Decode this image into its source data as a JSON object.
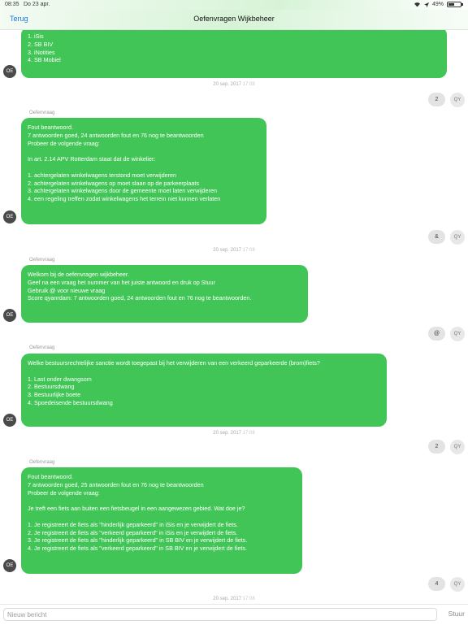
{
  "status": {
    "time": "08:35",
    "date": "Do 23 apr.",
    "battery": "49%",
    "battery_level": 0.49
  },
  "nav": {
    "back_label": "Terug",
    "title": "Oefenvragen Wijkbeheer"
  },
  "thread": [
    {
      "type": "bot",
      "sender": "",
      "avatar": "OE",
      "text": "1. iSis\n2. SB BIV\n3. iNotities\n4. SB Mobiel"
    },
    {
      "type": "timestamp",
      "date": "20 sep. 2017",
      "time": "17:08"
    },
    {
      "type": "reply",
      "text": "2",
      "avatar": "QY"
    },
    {
      "type": "bot",
      "sender": "Oefenvraag",
      "avatar": "OE",
      "text": "Fout beantwoord.\n7 antwoorden goed, 24 antwoorden fout en 76 nog te beantwoorden\nProbeer de volgende vraag:\n\nIn art. 2.14 APV Rotterdam staat dat de winkelier:\n\n1. achtergelaten winkelwagens terstond moet verwijderen\n2. achtergelaten winkelwagens op moet slaan op de parkeerplaats\n3. achtergelaten winkelwagens door de gemeente moet laten verwijderen\n4. een regeling treffen zodat winkelwagens het terrein niet kunnen verlaten"
    },
    {
      "type": "timestamp",
      "date": "20 sep. 2017",
      "time": "17:08"
    },
    {
      "type": "reply",
      "text": "&",
      "avatar": "QY"
    },
    {
      "type": "bot",
      "sender": "Oefenvraag",
      "avatar": "OE",
      "text": "Welkom bij de oefenvragen wijkbeheer.\nGeef na een vraag het nummer van het juiste antwoord en druk op Stuur\nGebruik @ voor nieuwe vraag\nScore qyanrdam: 7 antwoorden goed, 24 antwoorden fout en 76 nog te beantwoorden."
    },
    {
      "type": "reply",
      "text": "@",
      "avatar": "QY"
    },
    {
      "type": "bot",
      "sender": "Oefenvraag",
      "avatar": "OE",
      "text": "Welke bestuursrechtelijke sanctie wordt toegepast bij het verwijderen van een verkeerd geparkeerde (brom)fiets?\n\n1. Last onder dwangsom\n2. Bestuursdwang\n3. Bestuurlijke boete\n4. Spoedeisende bestuursdwang"
    },
    {
      "type": "timestamp",
      "date": "20 sep. 2017",
      "time": "17:08"
    },
    {
      "type": "reply",
      "text": "2",
      "avatar": "QY"
    },
    {
      "type": "bot",
      "sender": "Oefenvraag",
      "avatar": "OE",
      "text": "Fout beantwoord.\n7 antwoorden goed, 25 antwoorden fout en 76 nog te beantwoorden\nProbeer de volgende vraag:\n\nJe treft een fiets aan buiten een fietsbeugel in een aangewezen gebied. Wat doe je?\n\n1. Je registreert de fiets als \"hinderlijk geparkeerd\" in iSis en je verwijdert de fiets.\n2. Je registreert de fiets als \"verkeerd geparkeerd\" in iSis en je verwijdert de fiets.\n3. Je registreert de fiets als \"hinderlijk geparkeerd\" in SB BIV en je verwijdert de fiets.\n4. Je registreert de fiets als \"verkeerd geparkeerd\" in SB BIV en je verwijdert de fiets."
    },
    {
      "type": "reply",
      "text": "4",
      "avatar": "QY"
    },
    {
      "type": "timestamp",
      "date": "20 sep. 2017",
      "time": "17:08"
    }
  ],
  "composer": {
    "placeholder": "Nieuw bericht",
    "send_label": "Stuur"
  },
  "colors": {
    "bubble": "#41c557",
    "link": "#1a73e8",
    "reply_bubble": "#e3e3e3"
  }
}
